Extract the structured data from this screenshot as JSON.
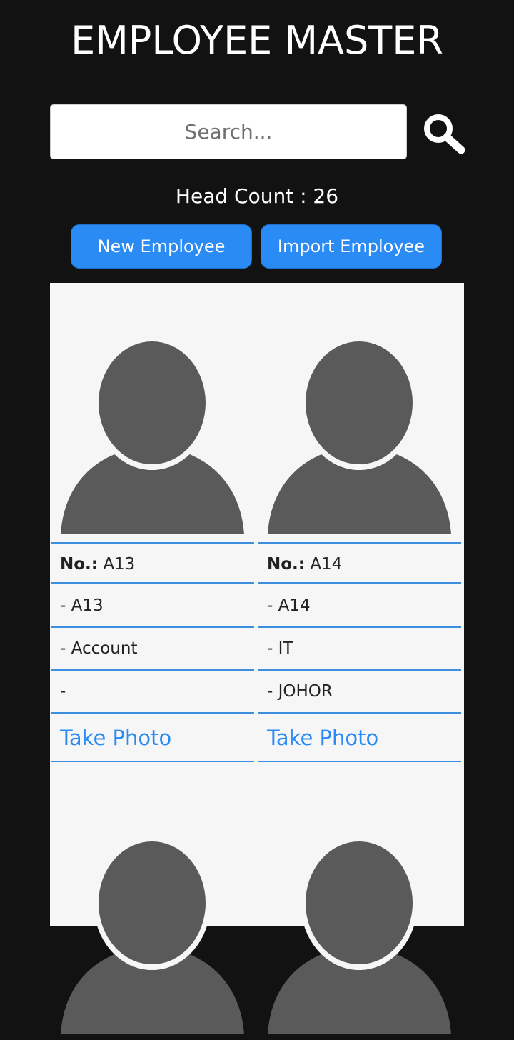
{
  "header": {
    "title": "EMPLOYEE MASTER"
  },
  "search": {
    "placeholder": "Search...",
    "icon": "search-icon"
  },
  "summary": {
    "head_count_text": "Head Count : 26"
  },
  "actions": {
    "new_label": "New Employee",
    "import_label": "Import Employee"
  },
  "colors": {
    "background": "#121212",
    "accent": "#2b8bf5",
    "card_bg": "#f6f6f6",
    "avatar": "#5a5a5a"
  },
  "employees": [
    {
      "no_label": "No.:",
      "no": "A13",
      "name": "- A13",
      "department": "- Account",
      "location": "-",
      "photo_link": "Take Photo"
    },
    {
      "no_label": "No.:",
      "no": "A14",
      "name": "- A14",
      "department": "- IT",
      "location": "- JOHOR",
      "photo_link": "Take Photo"
    }
  ]
}
